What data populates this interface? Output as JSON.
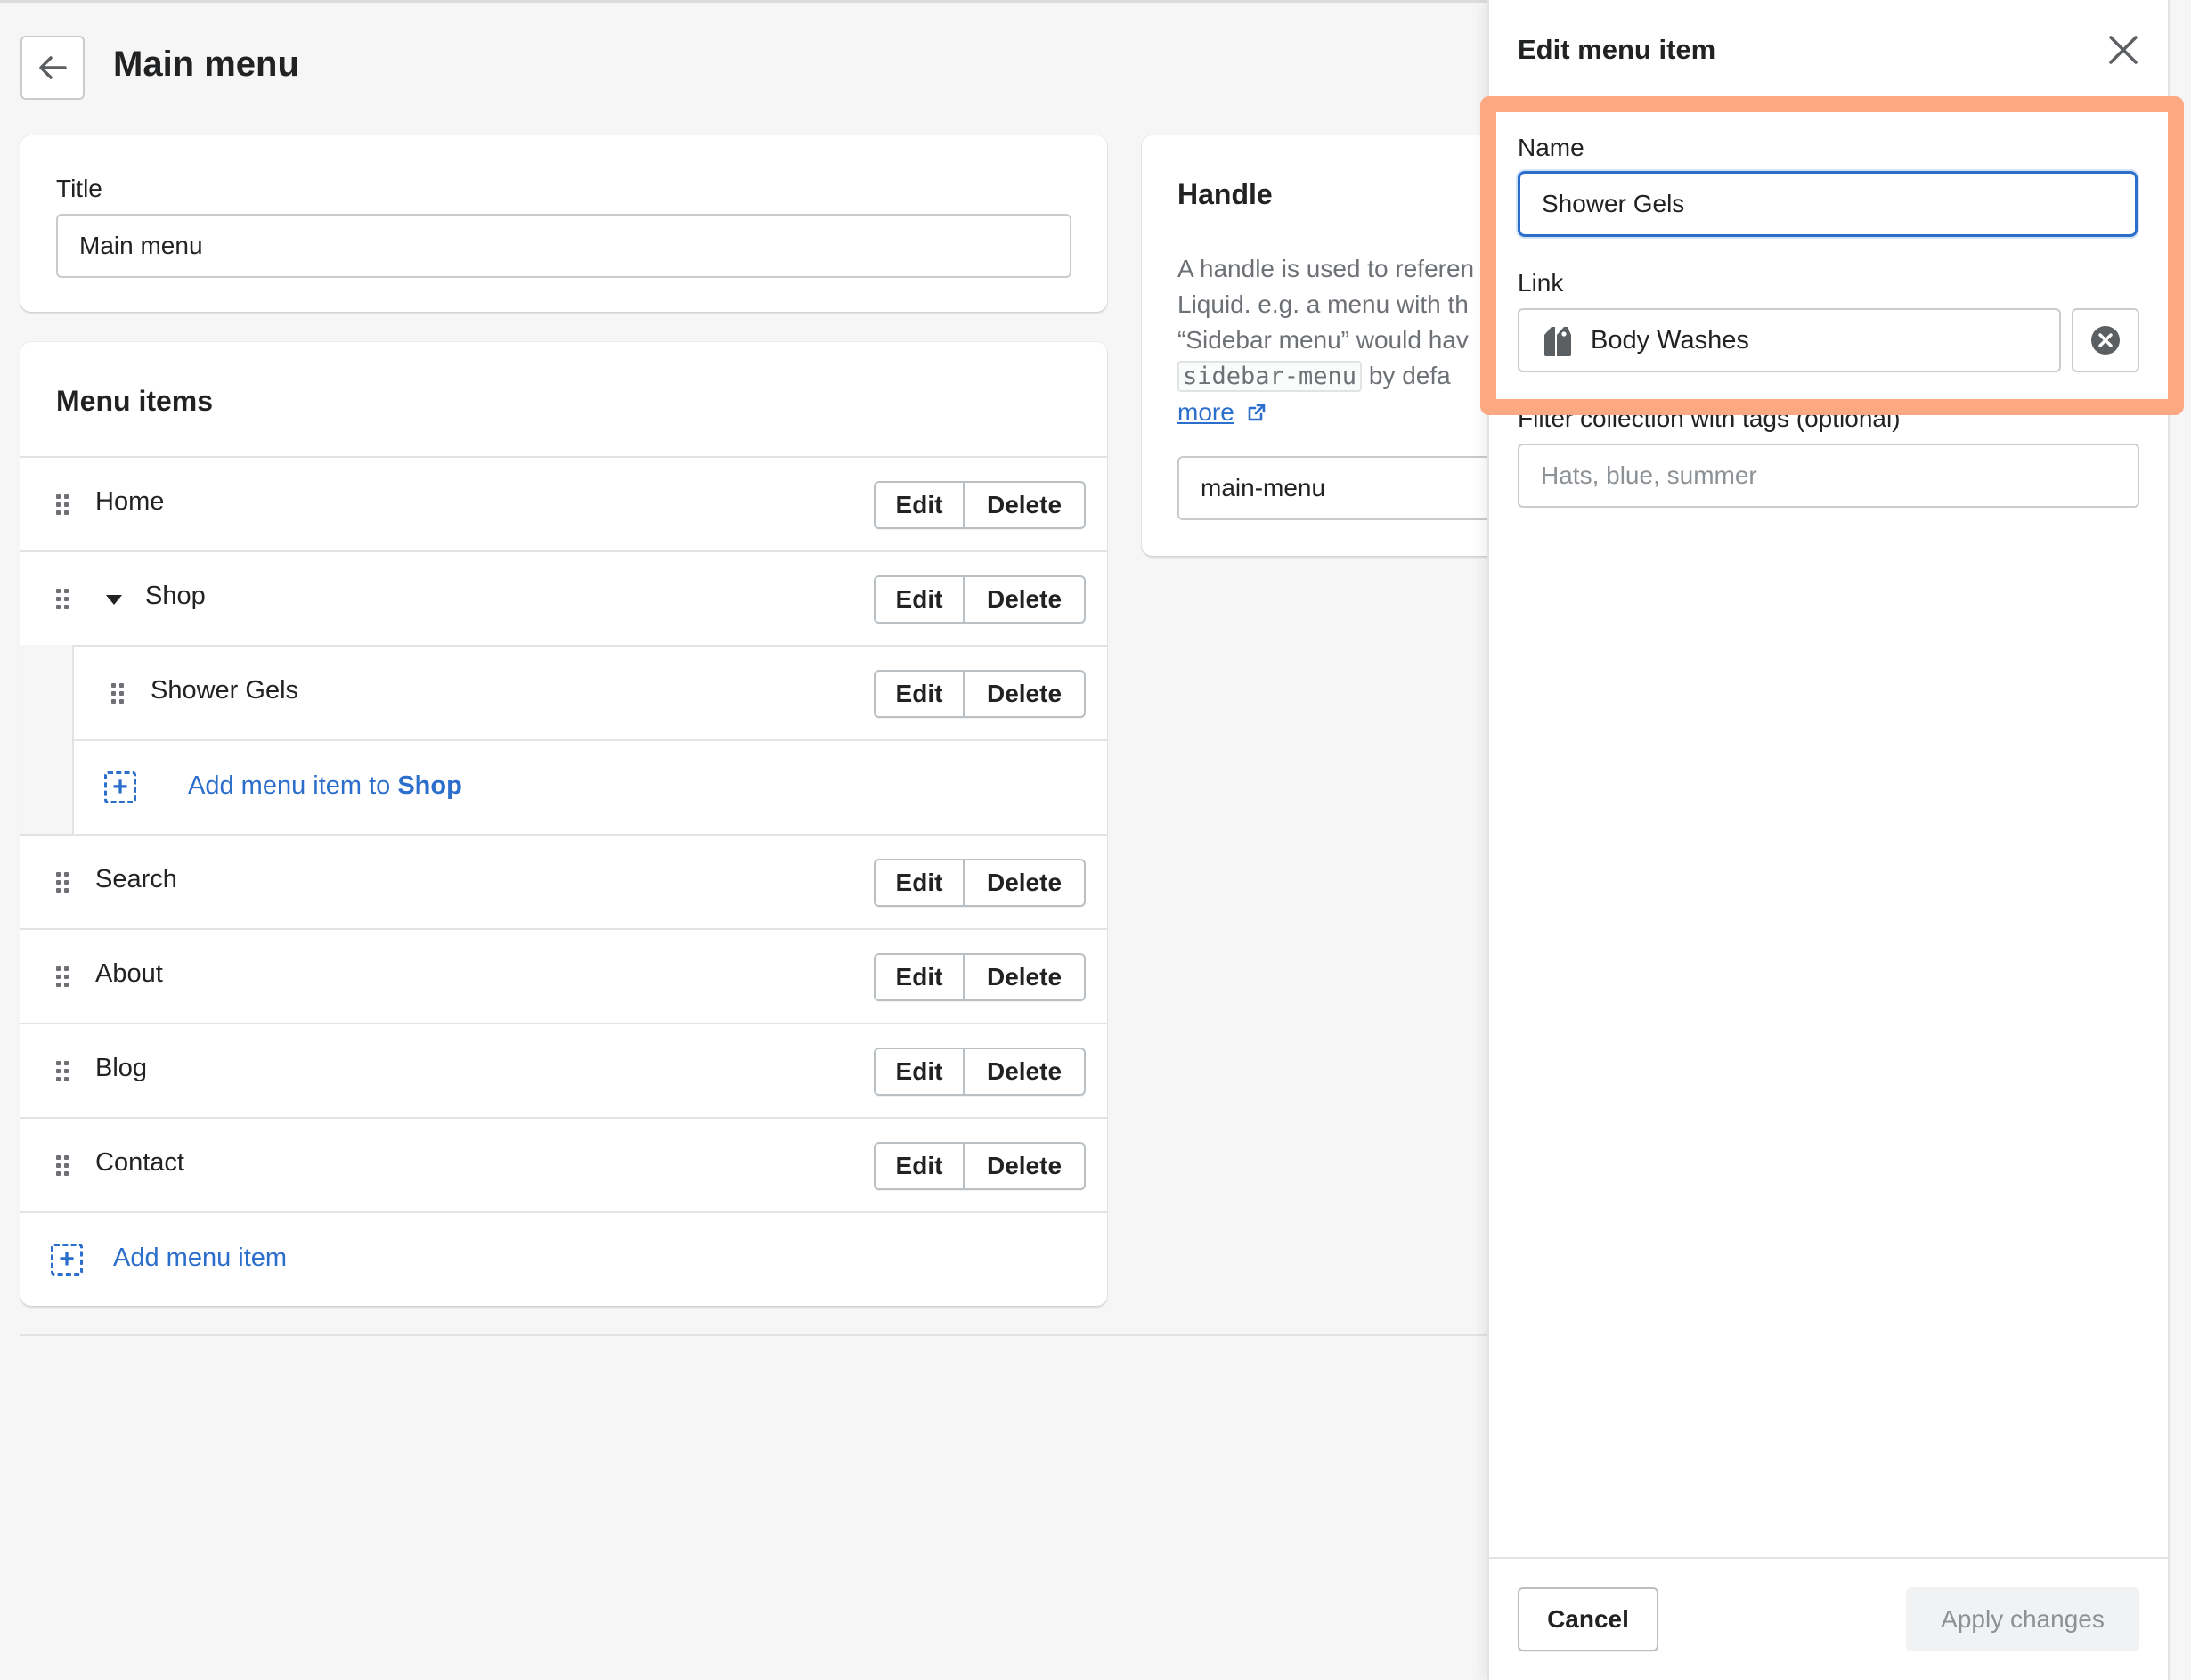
{
  "page": {
    "title": "Main menu",
    "back_icon": "arrow-left-icon"
  },
  "title_card": {
    "label": "Title",
    "value": "Main menu"
  },
  "menu": {
    "heading": "Menu items",
    "items": [
      {
        "label": "Home"
      },
      {
        "label": "Shop"
      },
      {
        "label": "Shower Gels"
      },
      {
        "label": "Search"
      },
      {
        "label": "About"
      },
      {
        "label": "Blog"
      },
      {
        "label": "Contact"
      }
    ],
    "edit_label": "Edit",
    "delete_label": "Delete",
    "add_to_shop_prefix": "Add menu item to ",
    "add_to_shop_target": "Shop",
    "add_item_label": "Add menu item"
  },
  "handle_card": {
    "title": "Handle",
    "desc_line1": "A handle is used to referen",
    "desc_line2": "Liquid. e.g. a menu with th",
    "desc_line3": "“Sidebar menu” would hav",
    "desc_code": "sidebar-menu",
    "desc_line4_rest": " by defa",
    "more_link": "more",
    "value": "main-menu"
  },
  "panel": {
    "title": "Edit menu item",
    "name_label": "Name",
    "name_value": "Shower Gels",
    "link_label": "Link",
    "link_value": "Body Washes",
    "tags_label": "Filter collection with tags (optional)",
    "tags_placeholder": "Hats, blue, summer",
    "cancel_label": "Cancel",
    "apply_label": "Apply changes"
  },
  "colors": {
    "accent": "#2c6ecb",
    "highlight": "#fca982"
  }
}
